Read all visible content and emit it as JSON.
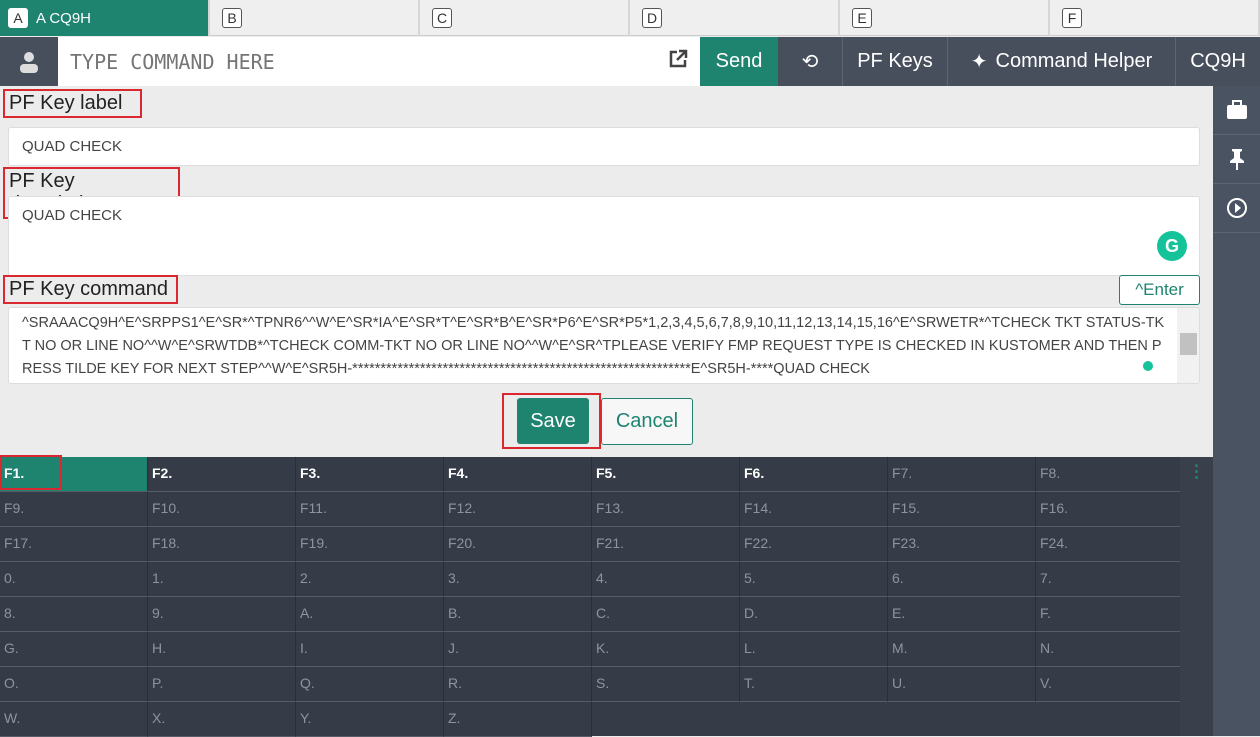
{
  "tabs": [
    {
      "key": "A",
      "label": "A CQ9H"
    },
    {
      "key": "B",
      "label": ""
    },
    {
      "key": "C",
      "label": ""
    },
    {
      "key": "D",
      "label": ""
    },
    {
      "key": "E",
      "label": ""
    },
    {
      "key": "F",
      "label": ""
    }
  ],
  "toolbar": {
    "placeholder": "TYPE COMMAND HERE",
    "send": "Send",
    "pf_keys": "PF Keys",
    "command_helper": "Command Helper",
    "session": "CQ9H"
  },
  "form": {
    "label_title": "PF Key label",
    "label_value": "QUAD CHECK",
    "description_title": "PF Key description",
    "description_value": "QUAD CHECK",
    "command_title": "PF Key command",
    "enter_button": "^Enter",
    "command_value": "^SRAAACQ9H^E^SRPPS1^E^SR*^TPNR6^^W^E^SR*IA^E^SR*T^E^SR*B^E^SR*P6^E^SR*P5*1,2,3,4,5,6,7,8,9,10,11,12,13,14,15,16^E^SRWETR*^TCHECK TKT STATUS-TKT NO OR LINE NO^^W^E^SRWTDB*^TCHECK COMM-TKT NO OR LINE NO^^W^E^SR^TPLEASE VERIFY FMP REQUEST TYPE IS CHECKED IN KUSTOMER AND THEN PRESS TILDE KEY FOR NEXT STEP^^W^E^SR5H-************************************************************E^SR5H-****QUAD CHECK",
    "save": "Save",
    "cancel": "Cancel"
  },
  "pf_grid": [
    "F1.",
    "F2.",
    "F3.",
    "F4.",
    "F5.",
    "F6.",
    "F7.",
    "F8.",
    "F9.",
    "F10.",
    "F11.",
    "F12.",
    "F13.",
    "F14.",
    "F15.",
    "F16.",
    "F17.",
    "F18.",
    "F19.",
    "F20.",
    "F21.",
    "F22.",
    "F23.",
    "F24.",
    "0.",
    "1.",
    "2.",
    "3.",
    "4.",
    "5.",
    "6.",
    "7.",
    "8.",
    "9.",
    "A.",
    "B.",
    "C.",
    "D.",
    "E.",
    "F.",
    "G.",
    "H.",
    "I.",
    "J.",
    "K.",
    "L.",
    "M.",
    "N.",
    "O.",
    "P.",
    "Q.",
    "R.",
    "S.",
    "T.",
    "U.",
    "V.",
    "W.",
    "X.",
    "Y.",
    "Z."
  ],
  "colors": {
    "accent": "#1e8470",
    "toolbar": "#474f5c",
    "grid": "#363c47",
    "highlight": "#d9282f"
  }
}
